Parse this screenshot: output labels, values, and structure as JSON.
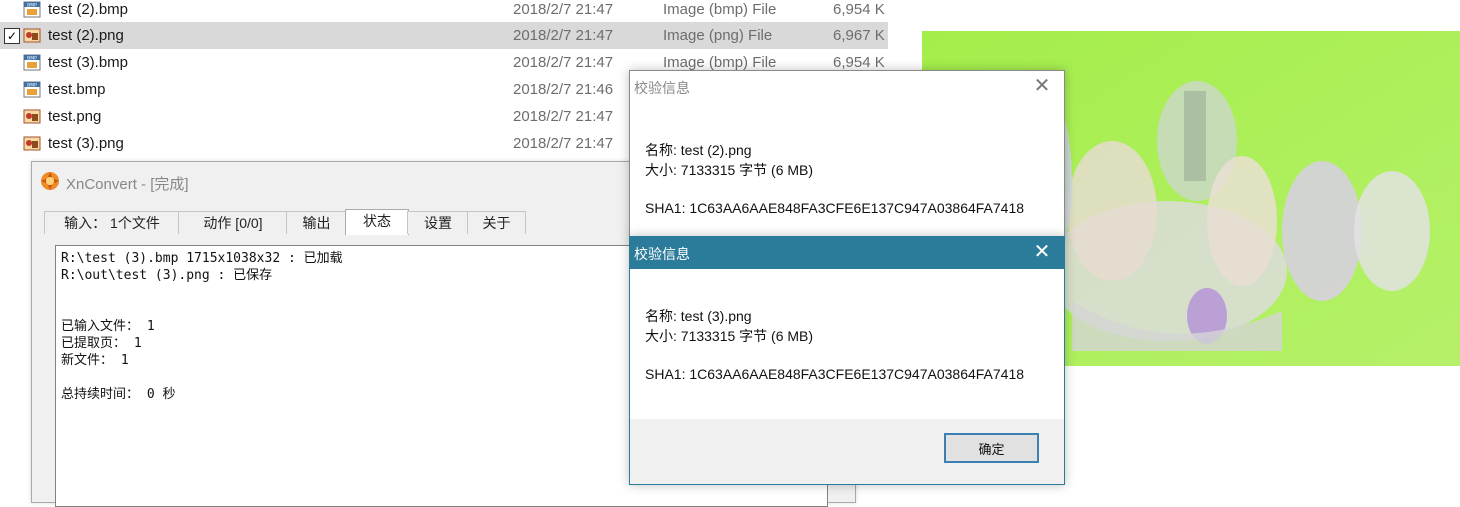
{
  "files": [
    {
      "name": "test (2).bmp",
      "date": "2018/2/7 21:47",
      "type": "Image (bmp) File",
      "size": "6,954 K",
      "icon": "bmp-file-icon",
      "selected": false
    },
    {
      "name": "test (2).png",
      "date": "2018/2/7 21:47",
      "type": "Image (png) File",
      "size": "6,967 K",
      "icon": "png-file-icon",
      "selected": true
    },
    {
      "name": "test (3).bmp",
      "date": "2018/2/7 21:47",
      "type": "Image (bmp) File",
      "size": "6,954 K",
      "icon": "bmp-file-icon",
      "selected": false
    },
    {
      "name": "test.bmp",
      "date": "2018/2/7 21:46",
      "type": "",
      "size": "",
      "icon": "bmp-file-icon",
      "selected": false
    },
    {
      "name": "test.png",
      "date": "2018/2/7 21:47",
      "type": "",
      "size": "",
      "icon": "png-file-icon",
      "selected": false
    },
    {
      "name": "test (3).png",
      "date": "2018/2/7 21:47",
      "type": "",
      "size": "",
      "icon": "png-file-icon",
      "selected": false
    }
  ],
  "xnconvert": {
    "title": "XnConvert - [完成]",
    "tabs": [
      "输入： 1个文件",
      "动作 [0/0]",
      "输出",
      "状态",
      "设置",
      "关于"
    ],
    "active_tab": 3,
    "log": [
      "R:\\test (3).bmp 1715x1038x32 : 已加载",
      "R:\\out\\test (3).png : 已保存",
      "",
      "",
      "已输入文件： 1",
      "已提取页： 1",
      "新文件： 1",
      "",
      "总持续时间： 0 秒"
    ]
  },
  "dialog1": {
    "title": "校验信息",
    "name": "名称: test (2).png",
    "size": "大小: 7133315 字节 (6 MB)",
    "sha1": "SHA1: 1C63AA6AAE848FA3CFE6E137C947A03864FA7418"
  },
  "dialog2": {
    "title": "校验信息",
    "name": "名称: test (3).png",
    "size": "大小: 7133315 字节 (6 MB)",
    "sha1": "SHA1: 1C63AA6AAE848FA3CFE6E137C947A03864FA7418",
    "ok_label": "确定"
  },
  "colors": {
    "accent": "#2b7b9b",
    "selection": "#d9d9d9",
    "preview_bg": "#a8f24a"
  }
}
